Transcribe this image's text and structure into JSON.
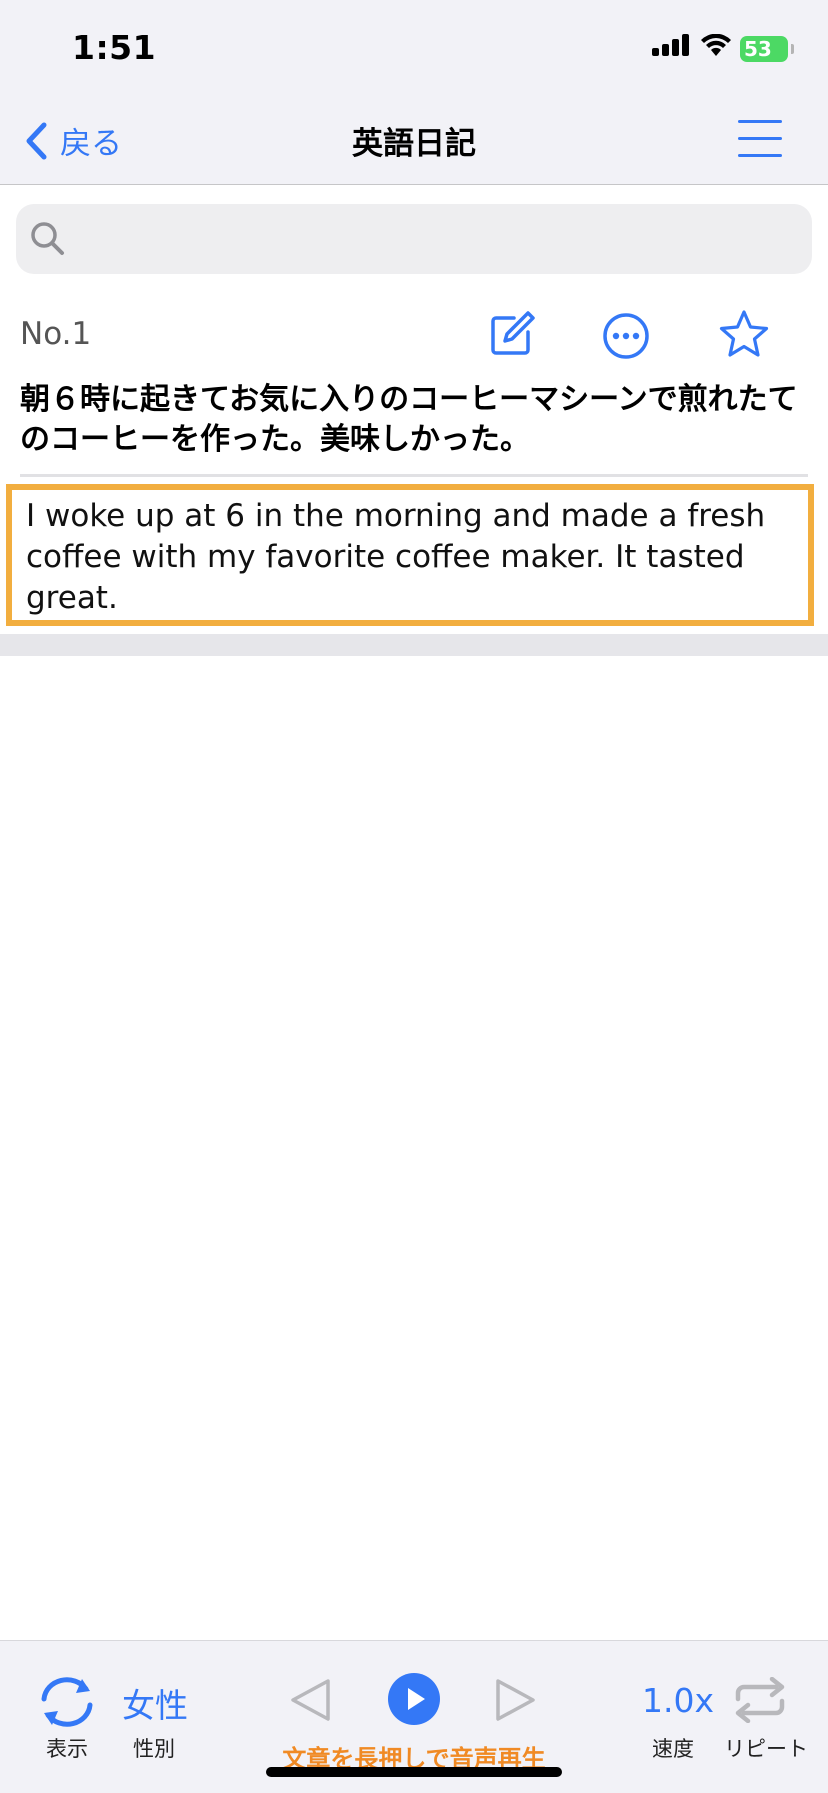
{
  "status_bar": {
    "time": "1:51",
    "battery": "53"
  },
  "nav": {
    "back_label": "戻る",
    "title": "英語日記"
  },
  "search": {
    "placeholder": ""
  },
  "entry": {
    "number": "No.1",
    "japanese": "朝６時に起きてお気に入りのコーヒーマシーンで煎れたてのコーヒーを作った。美味しかった。",
    "english": "I woke up at 6 in the morning and made a fresh coffee with my favorite coffee maker. It tasted great."
  },
  "toolbar": {
    "display_label": "表示",
    "gender_value": "女性",
    "gender_label": "性別",
    "speed_value": "1.0x",
    "speed_label": "速度",
    "repeat_label": "リピート",
    "hint": "文章を長押しで音声再生"
  },
  "colors": {
    "accent": "#3478f6",
    "highlight_border": "#f2ae3f",
    "hint": "#f08a24",
    "battery": "#4cd964"
  }
}
